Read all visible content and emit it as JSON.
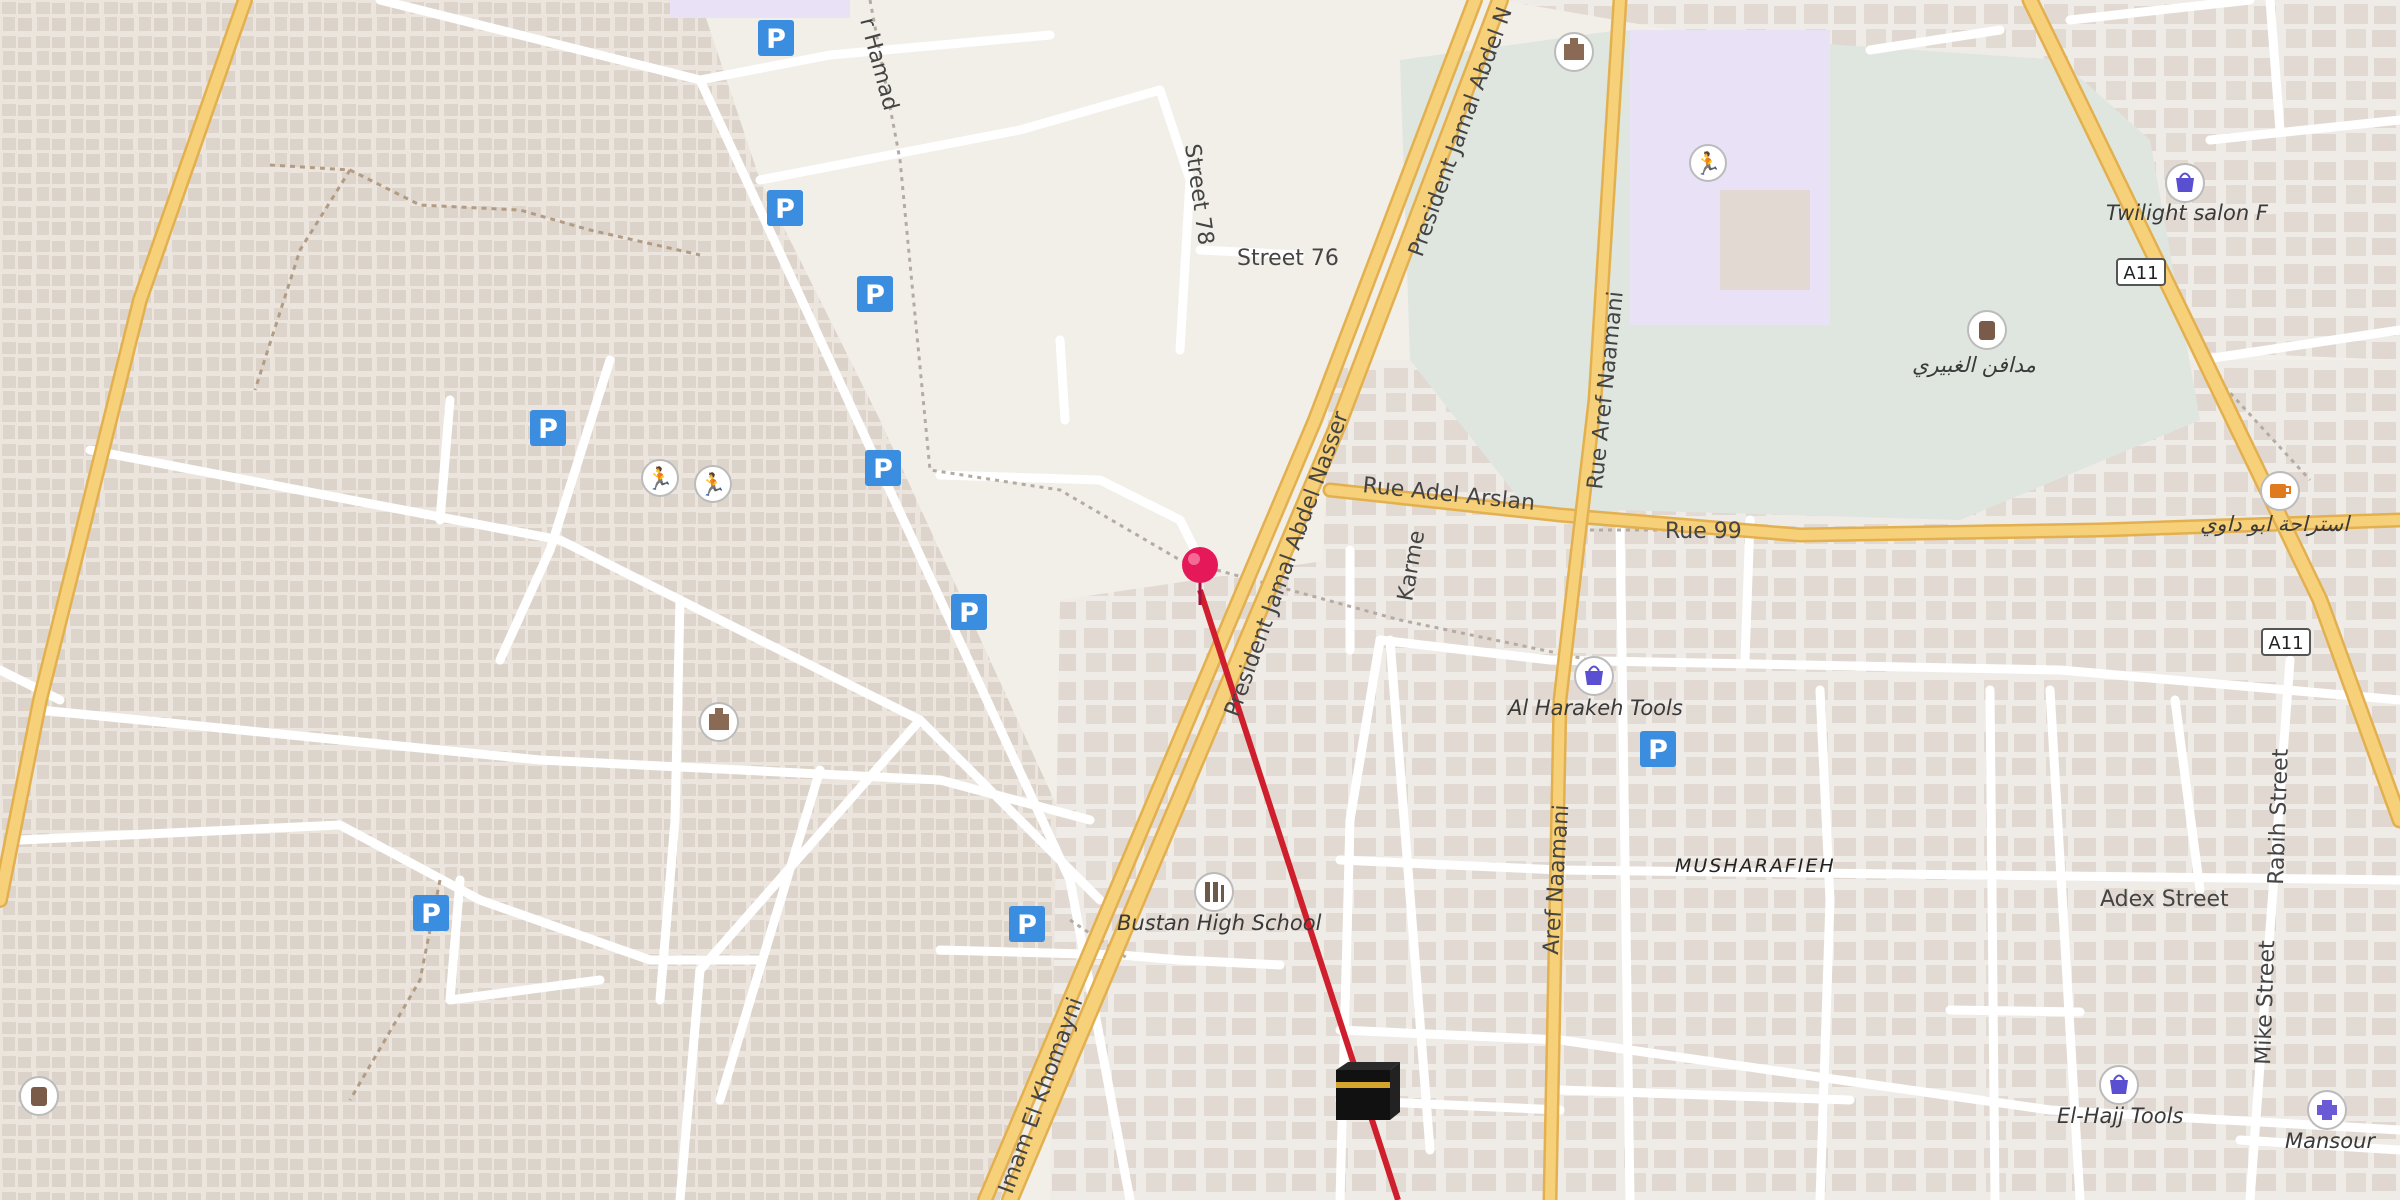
{
  "map": {
    "street_labels": [
      "Street 76",
      "Street 78",
      "Rue Adel Arslan",
      "Rue 99",
      "President Jamal Abdel N",
      "President Jamal Abdel Nasser",
      "Rue Aref Naamani",
      "Aref Naamani",
      "Imam El Khomayni",
      "Karme",
      "Adex Street",
      "Rabih Street",
      "Mike Street",
      "r Hamad"
    ],
    "road_shields": [
      "A11",
      "A11"
    ],
    "poi_labels": [
      "Twilight salon F",
      "مدافن الغبيري",
      "استراحة ابو داوي",
      "Al Harakeh Tools",
      "Bustan High School",
      "El-Hajj Tools",
      "Mansour"
    ],
    "district_label": "MUSHARAFIEH",
    "parking_symbol": "P",
    "icons": [
      "map-pin-icon",
      "kaaba-qibla-icon",
      "parking-icon",
      "shop-bag-icon",
      "cemetery-icon",
      "sports-icon",
      "school-icon",
      "cafe-icon",
      "pharmacy-icon",
      "religious-icon"
    ],
    "colors": {
      "background": "#f2efe9",
      "building": "#e0d8d0",
      "major_road": "#f7d07a",
      "major_road_casing": "#e3b04f",
      "minor_road": "#ffffff",
      "park": "#dfe6df",
      "sports_area": "#e9e2f6",
      "qibla_line": "#d01f2c",
      "pin": "#e5185a",
      "parking": "#3b8de0"
    }
  }
}
